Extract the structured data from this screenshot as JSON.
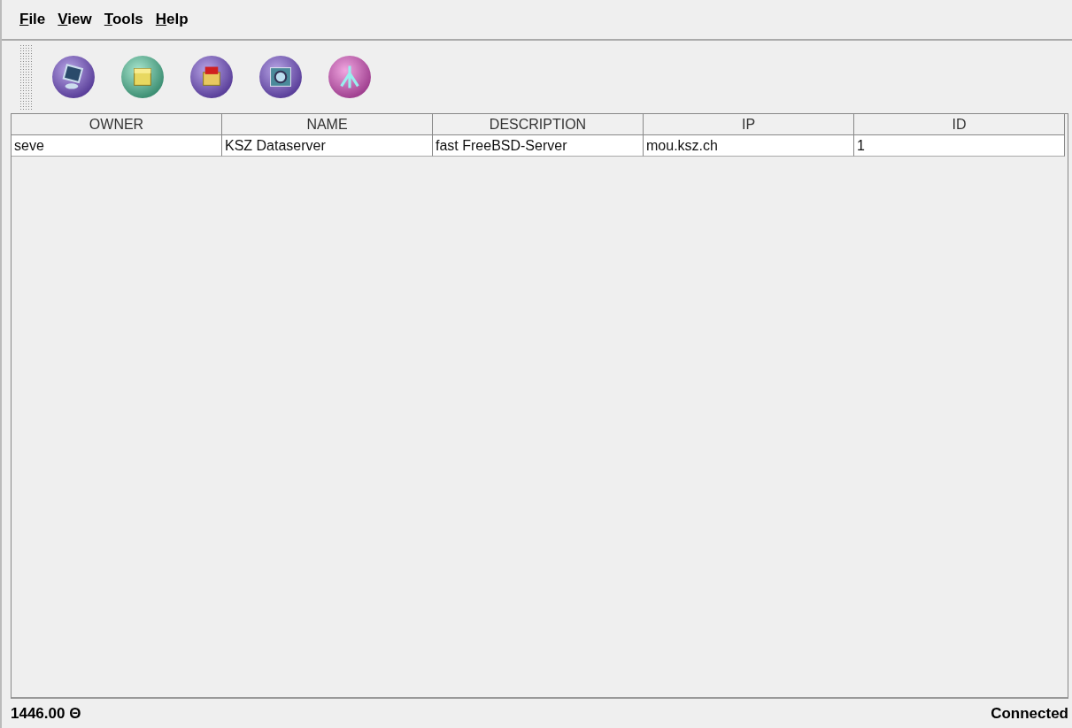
{
  "menu": [
    "File",
    "View",
    "Tools",
    "Help"
  ],
  "toolbar": {
    "buttons": [
      {
        "kind": "monitor"
      },
      {
        "kind": "box"
      },
      {
        "kind": "gift"
      },
      {
        "kind": "magnifier"
      },
      {
        "kind": "fork"
      }
    ]
  },
  "table": {
    "columns": [
      "OWNER",
      "NAME",
      "DESCRIPTION",
      "IP",
      "ID"
    ],
    "rows": [
      [
        "seve",
        "KSZ Dataserver",
        "fast FreeBSD-Server",
        "mou.ksz.ch",
        "1"
      ]
    ]
  },
  "status_bar": {
    "left": "1446.00 Θ",
    "right": "Connected"
  }
}
